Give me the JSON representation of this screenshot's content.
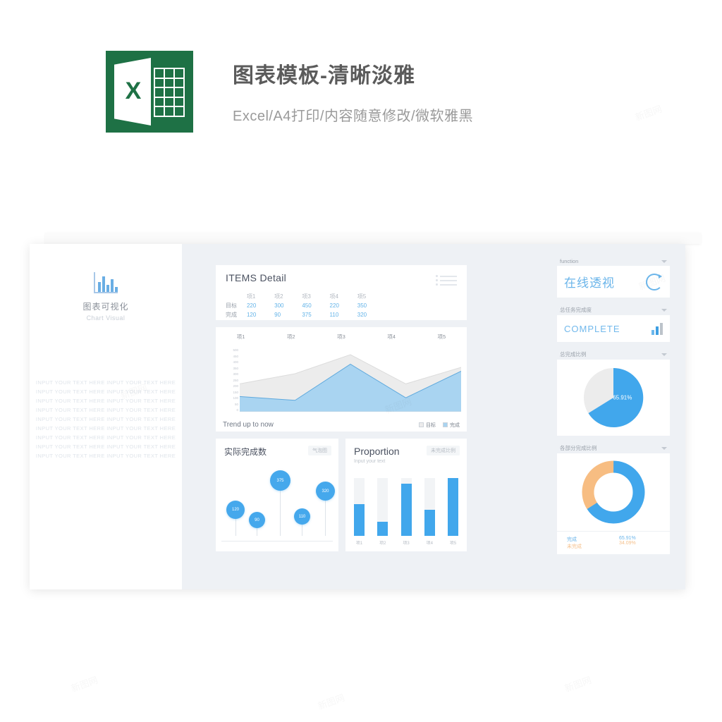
{
  "header": {
    "icon_letter": "X",
    "title": "图表模板-清晰淡雅",
    "subtitle": "Excel/A4打印/内容随意修改/微软雅黑"
  },
  "sidebar": {
    "logo_cn": "图表可视化",
    "logo_en": "Chart Visual",
    "filler_text": "INPUT YOUR TEXT HERE INPUT YOUR TEXT HERE INPUT YOUR TEXT HERE INPUT YOUR TEXT HERE INPUT YOUR TEXT HERE INPUT YOUR TEXT HERE INPUT YOUR TEXT HERE INPUT YOUR TEXT HERE INPUT YOUR TEXT HERE INPUT YOUR TEXT HERE INPUT YOUR TEXT HERE INPUT YOUR TEXT HERE INPUT YOUR TEXT HERE INPUT YOUR TEXT HERE INPUT YOUR TEXT HERE INPUT YOUR TEXT HERE INPUT YOUR TEXT HERE INPUT YOUR TEXT HERE"
  },
  "items_detail": {
    "title": "ITEMS Detail",
    "columns": [
      "项1",
      "项2",
      "项3",
      "项4",
      "项5"
    ],
    "row_target_label": "目标",
    "row_done_label": "完成",
    "target": [
      220,
      300,
      450,
      220,
      350
    ],
    "done": [
      120,
      90,
      375,
      110,
      320
    ]
  },
  "trend": {
    "footer_title": "Trend up to now",
    "legend": [
      "目标",
      "完成"
    ]
  },
  "bubble": {
    "title": "实际完成数",
    "tag": "气泡图"
  },
  "proportion": {
    "title": "Proportion",
    "subtitle": "Input your text",
    "tag": "未完成比例"
  },
  "right": {
    "function_label": "function",
    "function_value": "在线透视",
    "complete_label": "总任务完成度",
    "complete_value": "COMPLETE",
    "pie_label": "总完成比例",
    "pie_value": "65.91%",
    "donut_label": "各部分完成比例",
    "donut_legend": [
      {
        "name": "完成",
        "value": "65.91%"
      },
      {
        "name": "未完成",
        "value": "34.09%"
      }
    ]
  },
  "colors": {
    "accent_blue": "#41a7ec",
    "light_blue": "#a8d4f2",
    "orange": "#f7bd82",
    "grey": "#ebedef",
    "excel_green": "#1e7145"
  },
  "chart_data": [
    {
      "type": "area",
      "title": "Trend up to now",
      "categories": [
        "项1",
        "项2",
        "项3",
        "项4",
        "项5"
      ],
      "series": [
        {
          "name": "目标",
          "values": [
            220,
            300,
            450,
            220,
            350
          ]
        },
        {
          "name": "完成",
          "values": [
            120,
            90,
            375,
            110,
            320
          ]
        }
      ],
      "ylim": [
        0,
        500
      ],
      "yticks": [
        0,
        50,
        100,
        150,
        200,
        250,
        300,
        350,
        400,
        450,
        500
      ],
      "ylabel": "",
      "xlabel": "",
      "grid": false,
      "legend_position": "bottom-right"
    },
    {
      "type": "scatter",
      "title": "实际完成数",
      "categories": [
        "项1",
        "项2",
        "项3",
        "项4",
        "项5"
      ],
      "values": [
        120,
        90,
        375,
        110,
        320
      ],
      "labels": [
        "120",
        "90",
        "375",
        "110",
        "320"
      ]
    },
    {
      "type": "bar",
      "title": "Proportion",
      "categories": [
        "项1",
        "项2",
        "项3",
        "项4",
        "项5"
      ],
      "values": [
        55,
        25,
        90,
        45,
        100
      ],
      "ylim": [
        0,
        100
      ],
      "grid": false
    },
    {
      "type": "pie",
      "title": "总完成比例",
      "labels": [
        "完成",
        "未完成"
      ],
      "values": [
        65.91,
        34.09
      ],
      "data_labels": [
        "65.91%",
        ""
      ]
    },
    {
      "type": "pie",
      "title": "各部分完成比例",
      "labels": [
        "完成",
        "未完成"
      ],
      "values": [
        65.91,
        34.09
      ],
      "data_labels": [
        "65.91%",
        "34.09%"
      ]
    }
  ]
}
